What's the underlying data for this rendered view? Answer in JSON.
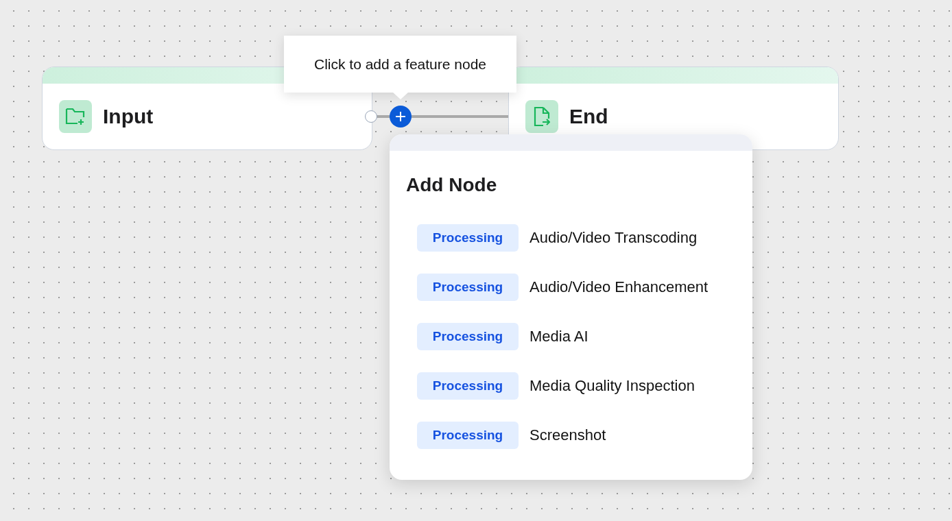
{
  "nodes": [
    {
      "kind": "input",
      "title": "Input"
    },
    {
      "kind": "end",
      "title": "End"
    }
  ],
  "tooltip": {
    "text": "Click to add a feature node"
  },
  "add_node_menu": {
    "title": "Add Node",
    "items": [
      {
        "tag": "Processing",
        "label": "Audio/Video Transcoding"
      },
      {
        "tag": "Processing",
        "label": "Audio/Video Enhancement"
      },
      {
        "tag": "Processing",
        "label": "Media AI"
      },
      {
        "tag": "Processing",
        "label": "Media Quality Inspection"
      },
      {
        "tag": "Processing",
        "label": "Screenshot"
      }
    ]
  }
}
